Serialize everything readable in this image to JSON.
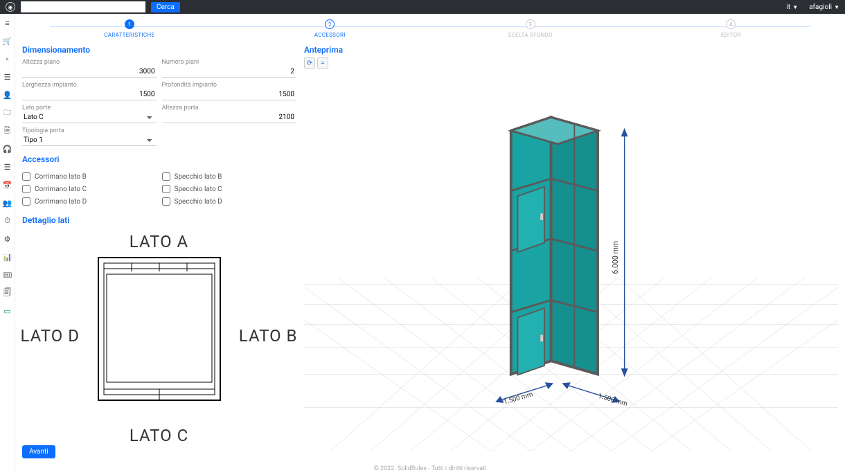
{
  "topbar": {
    "search_placeholder": "",
    "search_btn": "Cerca",
    "lang": "it",
    "user": "afagioli"
  },
  "steps": [
    {
      "num": "1",
      "label": "CARATTERISTICHE",
      "state": "active"
    },
    {
      "num": "2",
      "label": "ACCESSORI",
      "state": "next"
    },
    {
      "num": "3",
      "label": "SCELTA SFONDO",
      "state": "disabled"
    },
    {
      "num": "4",
      "label": "EDITOR",
      "state": "disabled"
    }
  ],
  "dim": {
    "title": "Dimensionamento",
    "altezza_piano_lbl": "Altezza piano",
    "altezza_piano": "3000",
    "numero_piani_lbl": "Numero piani",
    "numero_piani": "2",
    "larghezza_lbl": "Larghezza impianto",
    "larghezza": "1500",
    "profondita_lbl": "Profondità impianto",
    "profondita": "1500",
    "lato_porte_lbl": "Lato porte",
    "lato_porte": "Lato C",
    "altezza_porta_lbl": "Altezza porta",
    "altezza_porta": "2100",
    "tipologia_lbl": "Tipologia porta",
    "tipologia": "Tipo 1"
  },
  "acc": {
    "title": "Accessori",
    "corrimano_b": "Corrimano lato B",
    "corrimano_c": "Corrimano lato C",
    "corrimano_d": "Corrimano lato D",
    "specchio_b": "Specchio lato B",
    "specchio_c": "Specchio lato C",
    "specchio_d": "Specchio lato D"
  },
  "dettaglio": {
    "title": "Dettaglio lati",
    "lato_a": "LATO A",
    "lato_b": "LATO B",
    "lato_c": "LATO C",
    "lato_d": "LATO D"
  },
  "avanti": "Avanti",
  "preview": {
    "title": "Anteprima"
  },
  "measurements": {
    "height": "6.000 mm",
    "width": "1.500 mm",
    "depth": "1.500 mm"
  },
  "footer": "© 2022. SolidRules - Tutti i diritti riservati"
}
